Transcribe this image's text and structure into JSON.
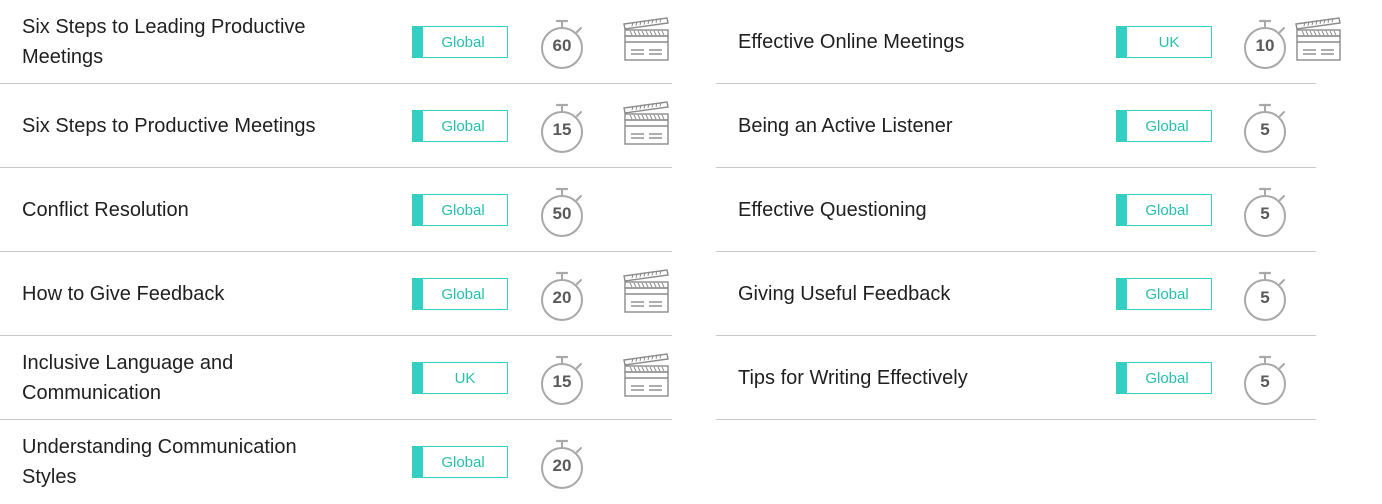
{
  "colors": {
    "accent": "#34cfc0",
    "divider": "#c8c8c8"
  },
  "icons": {
    "timer": "stopwatch-icon",
    "video": "clapperboard-icon"
  },
  "left": [
    {
      "title": "Six Steps to Leading Productive Meetings",
      "region": "Global",
      "minutes": "60",
      "video": true
    },
    {
      "title": "Six Steps to Productive Meetings",
      "region": "Global",
      "minutes": "15",
      "video": true
    },
    {
      "title": "Conflict Resolution",
      "region": "Global",
      "minutes": "50",
      "video": false
    },
    {
      "title": "How to Give Feedback",
      "region": "Global",
      "minutes": "20",
      "video": true
    },
    {
      "title": "Inclusive Language and Communication",
      "region": "UK",
      "minutes": "15",
      "video": true
    },
    {
      "title": "Understanding Communication Styles",
      "region": "Global",
      "minutes": "20",
      "video": false
    }
  ],
  "right": [
    {
      "title": "Effective Online Meetings",
      "region": "UK",
      "minutes": "10",
      "video": true
    },
    {
      "title": "Being an Active Listener",
      "region": "Global",
      "minutes": "5",
      "video": false
    },
    {
      "title": "Effective Questioning",
      "region": "Global",
      "minutes": "5",
      "video": false
    },
    {
      "title": "Giving Useful Feedback",
      "region": "Global",
      "minutes": "5",
      "video": false
    },
    {
      "title": "Tips for Writing Effectively",
      "region": "Global",
      "minutes": "5",
      "video": false
    }
  ]
}
